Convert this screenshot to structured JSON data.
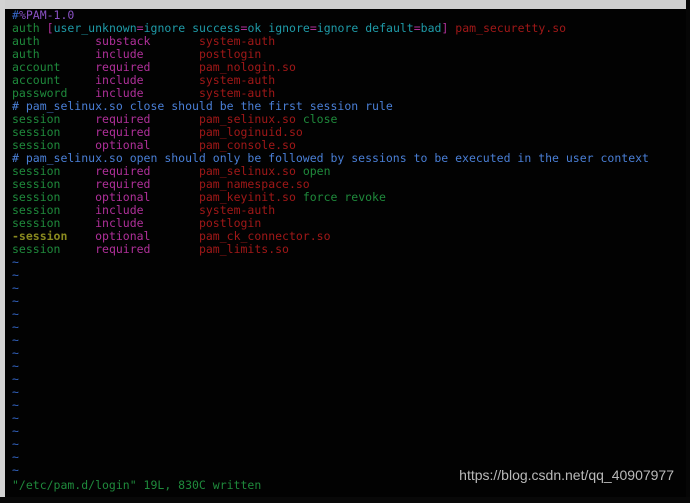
{
  "editor": {
    "name": "vim",
    "filename": "/etc/pam.d/login",
    "statusline": "\"/etc/pam.d/login\" 19L, 830C written",
    "empty_line_marker": "~",
    "empty_line_count": 17
  },
  "colors": {
    "background": "#020202",
    "frame_top": "#cfcfcf",
    "frame_left": "#d3d3d3",
    "comment": "#4a7fd6",
    "field": "#1f8a3c",
    "field_negated": "#8a8a1f",
    "control": "#b0309a",
    "module": "#a01818",
    "argument": "#1f8a3c",
    "param_key": "#1f9ba8",
    "tilde": "#3465c4",
    "statusline_text": "#1f8a3c",
    "watermark": "#c9c9c9"
  },
  "watermark": {
    "text": "https://blog.csdn.net/qq_40907977"
  },
  "lines": [
    {
      "type": "header",
      "hash": "#",
      "text": "%PAM-1.0"
    },
    {
      "type": "rule_complex",
      "field": "auth",
      "open_bracket": "[",
      "params": [
        {
          "key": "user_unknown",
          "eq": "=",
          "value": "ignore"
        },
        {
          "key": "success",
          "eq": "=",
          "value": "ok"
        },
        {
          "key": "ignore",
          "eq": "=",
          "value": "ignore"
        },
        {
          "key": "default",
          "eq": "=",
          "value": "bad"
        }
      ],
      "close_bracket": "]",
      "module": "pam_securetty.so"
    },
    {
      "type": "rule",
      "field": "auth",
      "control": "substack",
      "module": "system-auth",
      "args": ""
    },
    {
      "type": "rule",
      "field": "auth",
      "control": "include",
      "module": "postlogin",
      "args": ""
    },
    {
      "type": "rule",
      "field": "account",
      "control": "required",
      "module": "pam_nologin.so",
      "args": ""
    },
    {
      "type": "rule",
      "field": "account",
      "control": "include",
      "module": "system-auth",
      "args": ""
    },
    {
      "type": "rule",
      "field": "password",
      "control": "include",
      "module": "system-auth",
      "args": ""
    },
    {
      "type": "comment",
      "text": "# pam_selinux.so close should be the first session rule"
    },
    {
      "type": "rule",
      "field": "session",
      "control": "required",
      "module": "pam_selinux.so",
      "args": "close"
    },
    {
      "type": "rule",
      "field": "session",
      "control": "required",
      "module": "pam_loginuid.so",
      "args": ""
    },
    {
      "type": "rule",
      "field": "session",
      "control": "optional",
      "module": "pam_console.so",
      "args": ""
    },
    {
      "type": "comment",
      "text": "# pam_selinux.so open should only be followed by sessions to be executed in the user context"
    },
    {
      "type": "rule",
      "field": "session",
      "control": "required",
      "module": "pam_selinux.so",
      "args": "open"
    },
    {
      "type": "rule",
      "field": "session",
      "control": "required",
      "module": "pam_namespace.so",
      "args": ""
    },
    {
      "type": "rule",
      "field": "session",
      "control": "optional",
      "module": "pam_keyinit.so",
      "args": "force revoke"
    },
    {
      "type": "rule",
      "field": "session",
      "control": "include",
      "module": "system-auth",
      "args": ""
    },
    {
      "type": "rule",
      "field": "session",
      "control": "include",
      "module": "postlogin",
      "args": ""
    },
    {
      "type": "rule_negated",
      "field": "-session",
      "control": "optional",
      "module": "pam_ck_connector.so",
      "args": ""
    },
    {
      "type": "rule",
      "field": "session",
      "control": "required",
      "module": "pam_limits.so",
      "args": ""
    }
  ]
}
